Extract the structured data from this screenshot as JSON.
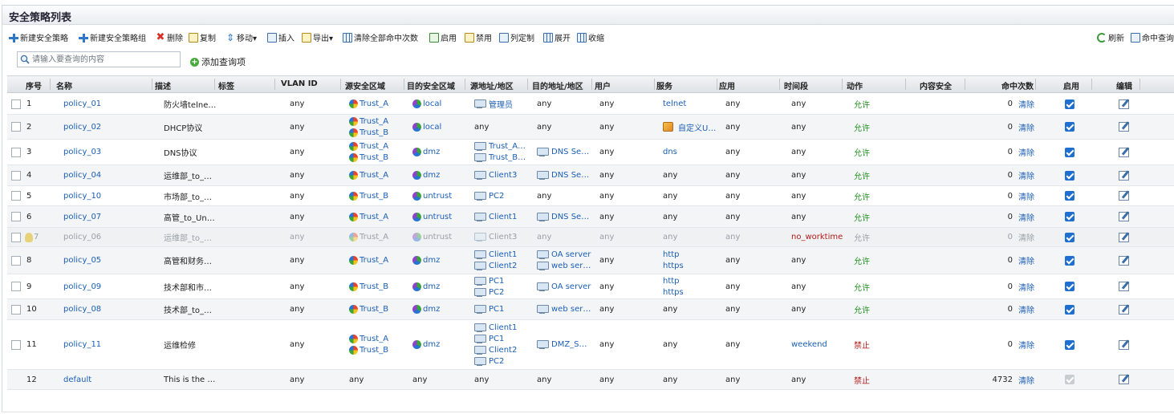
{
  "title": "安全策略列表",
  "toolbar": {
    "new_policy": "新建安全策略",
    "new_policy_group": "新建安全策略组",
    "delete": "删除",
    "copy": "复制",
    "move": "移动▾",
    "insert": "插入",
    "export": "导出▾",
    "clear_hits": "清除全部命中次数",
    "enable": "启用",
    "disable": "禁用",
    "columns": "列定制",
    "expand": "展开",
    "collapse": "收缩",
    "refresh": "刷新",
    "hit_query": "命中查询"
  },
  "search": {
    "placeholder": "请输入要查询的内容",
    "add_query": "添加查询项"
  },
  "columns": [
    "序号",
    "名称",
    "描述",
    "标签",
    "VLAN ID",
    "源安全区域",
    "目的安全区域",
    "源地址/地区",
    "目的地址/地区",
    "用户",
    "服务",
    "应用",
    "时间段",
    "动作",
    "内容安全",
    "命中次数",
    "启用",
    "编辑"
  ],
  "clear_label": "清除",
  "rows": [
    {
      "no": "1",
      "name": "policy_01",
      "desc": "防火墙telne…",
      "vlan": "any",
      "src_zone": [
        "Trust_A"
      ],
      "dst_zone": [
        "local"
      ],
      "src_addr": [
        "管理员"
      ],
      "dst_addr": [
        "any"
      ],
      "user": "any",
      "service": [
        "telnet"
      ],
      "app": "any",
      "time": "any",
      "action": "允许",
      "hits": "0",
      "enabled": true
    },
    {
      "no": "2",
      "name": "policy_02",
      "desc": "DHCP协议",
      "vlan": "any",
      "src_zone": [
        "Trust_A",
        "Trust_B"
      ],
      "dst_zone": [
        "local"
      ],
      "src_addr": [
        "any"
      ],
      "dst_addr": [
        "any"
      ],
      "user": "any",
      "service": [
        "自定义U…"
      ],
      "app": "any",
      "time": "any",
      "action": "允许",
      "hits": "0",
      "enabled": true
    },
    {
      "no": "3",
      "name": "policy_03",
      "desc": "DNS协议",
      "vlan": "any",
      "src_zone": [
        "Trust_A",
        "Trust_B"
      ],
      "dst_zone": [
        "dmz"
      ],
      "src_addr": [
        "Trust_A…",
        "Trust_B…"
      ],
      "dst_addr": [
        "DNS Se…"
      ],
      "user": "any",
      "service": [
        "dns"
      ],
      "app": "any",
      "time": "any",
      "action": "允许",
      "hits": "0",
      "enabled": true
    },
    {
      "no": "4",
      "name": "policy_04",
      "desc": "运维部_to_…",
      "vlan": "any",
      "src_zone": [
        "Trust_A"
      ],
      "dst_zone": [
        "dmz"
      ],
      "src_addr": [
        "Client3"
      ],
      "dst_addr": [
        "DNS Se…"
      ],
      "user": "any",
      "service": [
        "any"
      ],
      "app": "any",
      "time": "any",
      "action": "允许",
      "hits": "0",
      "enabled": true
    },
    {
      "no": "5",
      "name": "policy_10",
      "desc": "市场部_to_…",
      "vlan": "any",
      "src_zone": [
        "Trust_B"
      ],
      "dst_zone": [
        "untrust"
      ],
      "src_addr": [
        "PC2"
      ],
      "dst_addr": [
        "any"
      ],
      "user": "any",
      "service": [
        "any"
      ],
      "app": "any",
      "time": "any",
      "action": "允许",
      "hits": "0",
      "enabled": true
    },
    {
      "no": "6",
      "name": "policy_07",
      "desc": "高管_to_Un…",
      "vlan": "any",
      "src_zone": [
        "Trust_A"
      ],
      "dst_zone": [
        "untrust"
      ],
      "src_addr": [
        "Client1"
      ],
      "dst_addr": [
        "DNS Se…"
      ],
      "user": "any",
      "service": [
        "any"
      ],
      "app": "any",
      "time": "any",
      "action": "允许",
      "hits": "0",
      "enabled": true
    },
    {
      "no": "7",
      "name": "policy_06",
      "desc": "运维部_to_…",
      "vlan": "any",
      "src_zone": [
        "Trust_A"
      ],
      "dst_zone": [
        "untrust"
      ],
      "src_addr": [
        "Client3"
      ],
      "dst_addr": [
        "any"
      ],
      "user": "any",
      "service": [
        "any"
      ],
      "app": "any",
      "time": "no_worktime",
      "action": "允许",
      "hits": "0",
      "enabled": true,
      "disabled_row": true
    },
    {
      "no": "8",
      "name": "policy_05",
      "desc": "高管和财务…",
      "vlan": "any",
      "src_zone": [
        "Trust_A"
      ],
      "dst_zone": [
        "dmz"
      ],
      "src_addr": [
        "Client1",
        "Client2"
      ],
      "dst_addr": [
        "OA server",
        "web ser…"
      ],
      "user": "any",
      "service": [
        "http",
        "https"
      ],
      "app": "any",
      "time": "any",
      "action": "允许",
      "hits": "0",
      "enabled": true
    },
    {
      "no": "9",
      "name": "policy_09",
      "desc": "技术部和市…",
      "vlan": "any",
      "src_zone": [
        "Trust_B"
      ],
      "dst_zone": [
        "dmz"
      ],
      "src_addr": [
        "PC1",
        "PC2"
      ],
      "dst_addr": [
        "OA server"
      ],
      "user": "any",
      "service": [
        "http",
        "https"
      ],
      "app": "any",
      "time": "any",
      "action": "允许",
      "hits": "0",
      "enabled": true
    },
    {
      "no": "10",
      "name": "policy_08",
      "desc": "技术部_to_…",
      "vlan": "any",
      "src_zone": [
        "Trust_B"
      ],
      "dst_zone": [
        "dmz"
      ],
      "src_addr": [
        "PC1"
      ],
      "dst_addr": [
        "web ser…"
      ],
      "user": "any",
      "service": [
        "any"
      ],
      "app": "any",
      "time": "any",
      "action": "允许",
      "hits": "0",
      "enabled": true
    },
    {
      "no": "11",
      "name": "policy_11",
      "desc": "运维检修",
      "vlan": "any",
      "src_zone": [
        "Trust_A",
        "Trust_B"
      ],
      "dst_zone": [
        "dmz"
      ],
      "src_addr": [
        "Client1",
        "PC1",
        "Client2",
        "PC2"
      ],
      "dst_addr": [
        "DMZ_S…"
      ],
      "user": "any",
      "service": [
        "any"
      ],
      "app": "any",
      "time": "weekend",
      "action": "禁止",
      "hits": "0",
      "enabled": true
    },
    {
      "no": "12",
      "name": "default",
      "desc": "This is the …",
      "vlan": "any",
      "src_zone": [
        "any"
      ],
      "dst_zone": [
        "any"
      ],
      "src_addr": [
        "any"
      ],
      "dst_addr": [
        "any"
      ],
      "user": "any",
      "service": [
        "any"
      ],
      "app": "any",
      "time": "any",
      "action": "禁止",
      "hits": "4732",
      "enabled": true,
      "is_default": true
    }
  ]
}
